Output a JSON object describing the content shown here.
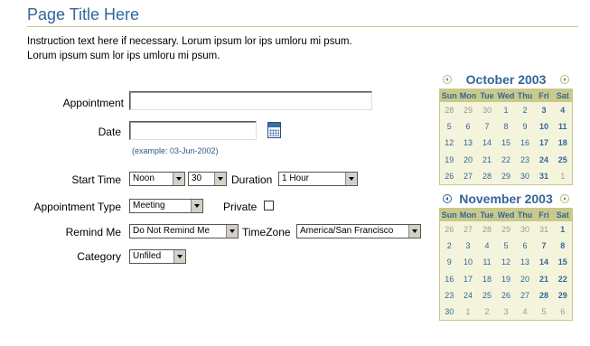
{
  "page": {
    "title": "Page Title Here",
    "instruction_line1": "Instruction text here if necessary. Lorum ipsum lor ips umloru mi psum.",
    "instruction_line2": "Lorum ipsum sum lor ips umloru mi psum."
  },
  "form": {
    "appointment_label": "Appointment",
    "appointment_value": "",
    "date_label": "Date",
    "date_value": "",
    "date_hint": "(example: 03-Jun-2002)",
    "start_time_label": "Start Time",
    "start_time_value": "Noon",
    "start_minutes_value": "30",
    "duration_label": "Duration",
    "duration_value": "1 Hour",
    "appointment_type_label": "Appointment Type",
    "appointment_type_value": "Meeting",
    "private_label": "Private",
    "remind_me_label": "Remind Me",
    "remind_me_value": "Do Not Remind Me",
    "timezone_label": "TimeZone",
    "timezone_value": "America/San Francisco",
    "category_label": "Category",
    "category_value": "Unfiled"
  },
  "calendars": [
    {
      "month": "October 2003",
      "weekdays": [
        "Sun",
        "Mon",
        "Tue",
        "Wed",
        "Thu",
        "Fri",
        "Sat"
      ],
      "weeks": [
        [
          "28",
          "29",
          "30",
          "1",
          "2",
          "3",
          "4"
        ],
        [
          "5",
          "6",
          "7",
          "8",
          "9",
          "10",
          "11"
        ],
        [
          "12",
          "13",
          "14",
          "15",
          "16",
          "17",
          "18"
        ],
        [
          "19",
          "20",
          "21",
          "22",
          "23",
          "24",
          "25"
        ],
        [
          "26",
          "27",
          "28",
          "29",
          "30",
          "31",
          "1"
        ]
      ]
    },
    {
      "month": "November 2003",
      "weekdays": [
        "Sun",
        "Mon",
        "Tue",
        "Wed",
        "Thu",
        "Fri",
        "Sat"
      ],
      "weeks": [
        [
          "26",
          "27",
          "28",
          "29",
          "30",
          "31",
          "1"
        ],
        [
          "2",
          "3",
          "4",
          "5",
          "6",
          "7",
          "8"
        ],
        [
          "9",
          "10",
          "11",
          "12",
          "13",
          "14",
          "15"
        ],
        [
          "16",
          "17",
          "18",
          "19",
          "20",
          "21",
          "22"
        ],
        [
          "23",
          "24",
          "25",
          "26",
          "27",
          "28",
          "29"
        ],
        [
          "30",
          "1",
          "2",
          "3",
          "4",
          "5",
          "6"
        ]
      ]
    }
  ]
}
